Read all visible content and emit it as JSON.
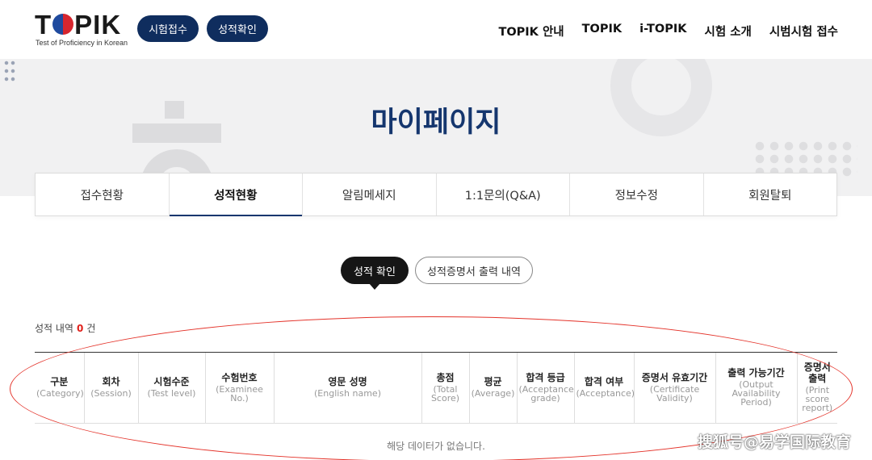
{
  "header": {
    "logo_main_pre": "T",
    "logo_main_post": "PIK",
    "logo_sub": "Test of Proficiency in Korean",
    "pills": [
      "시험접수",
      "성적확인"
    ],
    "nav": [
      "TOPIK 안내",
      "TOPIK",
      "i-TOPIK",
      "시험 소개",
      "시범시험 접수"
    ]
  },
  "banner": {
    "title": "마이페이지"
  },
  "tabs": [
    "접수현황",
    "성적현황",
    "알림메세지",
    "1:1문의(Q&A)",
    "정보수정",
    "회원탈퇴"
  ],
  "active_tab": "성적현황",
  "sub_buttons": {
    "active": "성적 확인",
    "inactive": "성적증명서 출력 내역"
  },
  "count": {
    "prefix": "성적 내역",
    "value": "0",
    "suffix": "건"
  },
  "table": {
    "columns": [
      {
        "ko": "구분",
        "en": "(Category)"
      },
      {
        "ko": "회차",
        "en": "(Session)"
      },
      {
        "ko": "시험수준",
        "en": "(Test level)"
      },
      {
        "ko": "수험번호",
        "en": "(Examinee No.)"
      },
      {
        "ko": "영문 성명",
        "en": "(English name)"
      },
      {
        "ko": "총점",
        "en": "(Total Score)"
      },
      {
        "ko": "평균",
        "en": "(Average)"
      },
      {
        "ko": "합격 등급",
        "en": "(Acceptance grade)"
      },
      {
        "ko": "합격 여부",
        "en": "(Acceptance)"
      },
      {
        "ko": "증명서 유효기간",
        "en": "(Certificate Validity)"
      },
      {
        "ko": "출력 가능기간",
        "en": "(Output Availability Period)"
      },
      {
        "ko": "증명서 출력",
        "en": "(Print score report)"
      }
    ],
    "empty_message": "해당 데이터가 없습니다."
  },
  "watermark": "搜狐号@易学国际教育",
  "colors": {
    "navy": "#0f2d5e",
    "title": "#15366e",
    "highlight": "#e0201a",
    "annotation": "#e4342b"
  }
}
